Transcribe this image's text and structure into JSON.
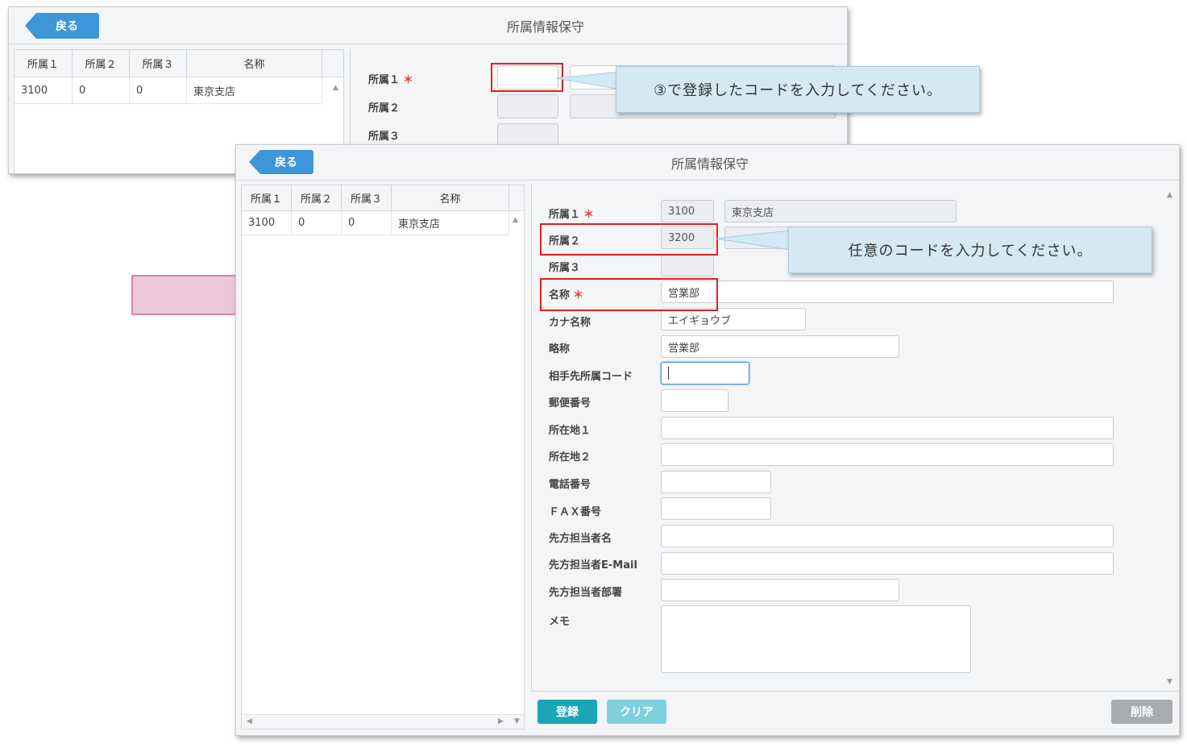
{
  "back_window": {
    "back_label": "戻る",
    "title": "所属情報保守",
    "grid": {
      "columns": [
        "所属１",
        "所属２",
        "所属３",
        "名称"
      ],
      "rows": [
        [
          "3100",
          "0",
          "0",
          "東京支店"
        ]
      ]
    },
    "labels": {
      "dept1": "所属１",
      "dept2": "所属２",
      "dept3": "所属３",
      "required_mark": "＊"
    },
    "callout": "③で登録したコードを入力してください。"
  },
  "front_window": {
    "back_label": "戻る",
    "title": "所属情報保守",
    "grid": {
      "columns": [
        "所属１",
        "所属２",
        "所属３",
        "名称"
      ],
      "rows": [
        [
          "3100",
          "0",
          "0",
          "東京支店"
        ]
      ]
    },
    "form": {
      "required_mark": "＊",
      "dept1": {
        "label": "所属１",
        "code": "3100",
        "name": "東京支店"
      },
      "dept2": {
        "label": "所属２",
        "code": "3200"
      },
      "dept3": {
        "label": "所属３",
        "code": ""
      },
      "name": {
        "label": "名称",
        "value": "営業部"
      },
      "kana_name": {
        "label": "カナ名称",
        "value": "エイギョウブ"
      },
      "short_name": {
        "label": "略称",
        "value": "営業部"
      },
      "partner_code": {
        "label": "相手先所属コード",
        "value": ""
      },
      "postal_code": {
        "label": "郵便番号",
        "value": ""
      },
      "address1": {
        "label": "所在地１",
        "value": ""
      },
      "address2": {
        "label": "所在地２",
        "value": ""
      },
      "phone": {
        "label": "電話番号",
        "value": ""
      },
      "fax": {
        "label": "ＦＡＸ番号",
        "value": ""
      },
      "contact_name": {
        "label": "先方担当者名",
        "value": ""
      },
      "contact_email": {
        "label": "先方担当者E-Mail",
        "value": ""
      },
      "contact_dept": {
        "label": "先方担当者部署",
        "value": ""
      },
      "memo": {
        "label": "メモ",
        "value": ""
      }
    },
    "footer": {
      "register_label": "登録",
      "clear_label": "クリア",
      "delete_label": "削除"
    },
    "callout": "任意のコードを入力してください。"
  },
  "colors": {
    "accent_blue": "#3c97d9",
    "register_teal": "#1aa6b7",
    "clear_light_teal": "#7fd0dc",
    "delete_gray": "#a8abb0",
    "highlight_red": "#e02020",
    "callout_bg": "#d4e9f4",
    "arrow_pink": "#ecc9d9"
  },
  "icons": [
    "back-arrow-icon",
    "scroll-up-icon",
    "scroll-down-icon",
    "scroll-left-icon",
    "scroll-right-icon",
    "right-arrow-icon"
  ]
}
